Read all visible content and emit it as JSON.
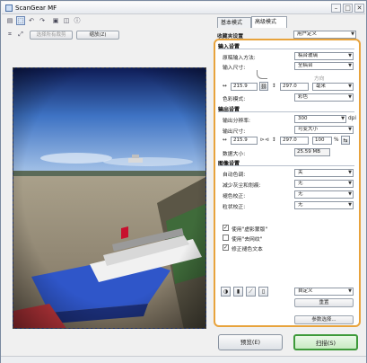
{
  "window": {
    "title": "ScanGear MF",
    "minimize": "–",
    "maximize": "□",
    "close": "✕"
  },
  "toolbar": {
    "icons": [
      "page-icon",
      "select-area-icon",
      "rotate-left-icon",
      "rotate-right-icon",
      "page-delete-icon",
      "copy-icon",
      "info-icon"
    ],
    "glyphs": [
      "▤",
      "⬚",
      "↶",
      "↷",
      "▣",
      "◫",
      "ⓘ"
    ],
    "crop_glyph": "⌗",
    "zoom_glyph": "⤢",
    "crop_frame_label": "选择所有裁剪",
    "zoom_label": "缩放(Z)"
  },
  "tabs": [
    {
      "label": "基本模式"
    },
    {
      "label": "高级模式"
    }
  ],
  "favorites": {
    "label": "收藏夹设置",
    "value": "用户定义"
  },
  "input": {
    "section": "输入设置",
    "source_label": "原稿输入方法:",
    "source_value": "稿台玻璃",
    "size_label": "输入尺寸:",
    "size_value": "全稿台",
    "orientation_label": "方向",
    "width": "215.9",
    "height": "297.0",
    "unit": "毫米",
    "color_label": "色彩模式:",
    "color_value": "彩色"
  },
  "output": {
    "section": "输出设置",
    "resolution_label": "输出分辨率:",
    "resolution_value": "300",
    "resolution_unit": "dpi",
    "size_label": "输出尺寸:",
    "size_value": "可变大小",
    "width": "215.9",
    "height": "297.0",
    "scale": "100",
    "scale_unit": "%",
    "datasize_label": "数据大小:",
    "datasize_value": "25.59 MB"
  },
  "image": {
    "section": "图像设置",
    "rows": [
      {
        "label": "自动色调:",
        "value": "关"
      },
      {
        "label": "减少灰尘和划痕:",
        "value": "无"
      },
      {
        "label": "褪色校正:",
        "value": "无"
      },
      {
        "label": "粒状校正:",
        "value": "无"
      }
    ],
    "checks": [
      {
        "label": "使用\"虚影蒙版\"",
        "checked": true
      },
      {
        "label": "使用\"去网纹\"",
        "checked": false
      },
      {
        "label": "修正褪色文本",
        "checked": true
      }
    ]
  },
  "adjust": {
    "icons": [
      "brightness-icon",
      "histogram-icon",
      "tone-curve-icon",
      "threshold-icon"
    ],
    "glyphs": [
      "◑",
      "▮",
      "⟋",
      "▯"
    ],
    "preset_value": "自定义",
    "reset_label": "重置"
  },
  "prefs_label": "参数选择...",
  "buttons": {
    "preview": "预览(E)",
    "scan": "扫描(S)"
  },
  "colors": {
    "accent_frame": "#e8a33c",
    "scan_border": "#3e9a3a"
  }
}
